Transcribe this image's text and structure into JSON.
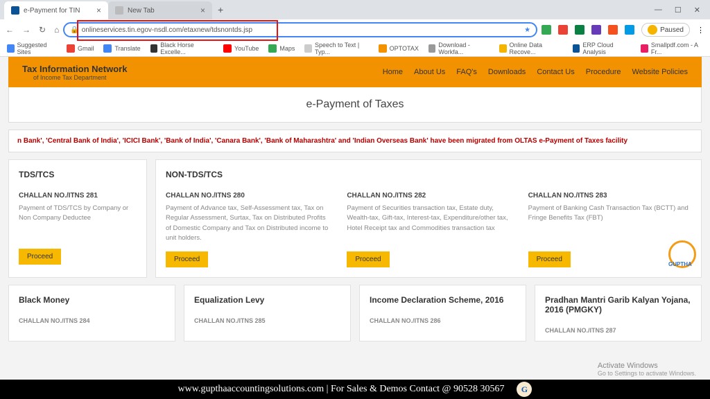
{
  "browser": {
    "tabs": [
      {
        "title": "e-Payment for TIN",
        "active": true
      },
      {
        "title": "New Tab",
        "active": false
      }
    ],
    "url": "onlineservices.tin.egov-nsdl.com/etaxnew/tdsnontds.jsp",
    "paused_label": "Paused",
    "bookmarks": [
      "Suggested Sites",
      "Gmail",
      "Translate",
      "Black Horse Excelle...",
      "YouTube",
      "Maps",
      "Speech to Text | Typ...",
      "OPTOTAX",
      "Download - Workfa...",
      "Online Data Recove...",
      "ERP Cloud Analysis",
      "Smallpdf.com - A Fr..."
    ]
  },
  "header": {
    "title": "Tax Information Network",
    "subtitle": "of Income Tax Department",
    "menu": [
      "Home",
      "About Us",
      "FAQ's",
      "Downloads",
      "Contact Us",
      "Procedure",
      "Website Policies"
    ]
  },
  "page_title": "e-Payment of Taxes",
  "marquee": "n Bank', 'Central Bank of India', 'ICICI Bank', 'Bank of India', 'Canara Bank', 'Bank of Maharashtra' and 'Indian Overseas Bank' have been migrated from OLTAS e-Payment of Taxes facility",
  "sections": {
    "tds": {
      "title": "TDS/TCS",
      "challan": "CHALLAN NO./ITNS 281",
      "desc": "Payment of TDS/TCS by Company or Non Company Deductee",
      "button": "Proceed"
    },
    "nontds": {
      "title": "NON-TDS/TCS",
      "cols": [
        {
          "challan": "CHALLAN NO./ITNS 280",
          "desc": "Payment of Advance tax, Self-Assessment tax, Tax on Regular Assessment, Surtax, Tax on Distributed Profits of Domestic Company and Tax on Distributed income to unit holders.",
          "button": "Proceed"
        },
        {
          "challan": "CHALLAN NO./ITNS 282",
          "desc": "Payment of Securities transaction tax, Estate duty, Wealth-tax, Gift-tax, Interest-tax, Expenditure/other tax, Hotel Receipt tax and Commodities transaction tax",
          "button": "Proceed"
        },
        {
          "challan": "CHALLAN NO./ITNS 283",
          "desc": "Payment of Banking Cash Transaction Tax (BCTT) and Fringe Benefits Tax (FBT)",
          "button": "Proceed"
        }
      ]
    }
  },
  "row2": [
    {
      "title": "Black Money",
      "challan": "CHALLAN NO./ITNS 284"
    },
    {
      "title": "Equalization Levy",
      "challan": "CHALLAN NO./ITNS 285"
    },
    {
      "title": "Income Declaration Scheme, 2016",
      "challan": "CHALLAN NO./ITNS 286"
    },
    {
      "title": "Pradhan Mantri Garib Kalyan Yojana, 2016 (PMGKY)",
      "challan": "CHALLAN NO./ITNS 287"
    }
  ],
  "watermark": "GUPTHA",
  "activate": {
    "line1": "Activate Windows",
    "line2": "Go to Settings to activate Windows."
  },
  "footer": "www.gupthaaccountingsolutions.com | For Sales & Demos Contact @ 90528 30567"
}
